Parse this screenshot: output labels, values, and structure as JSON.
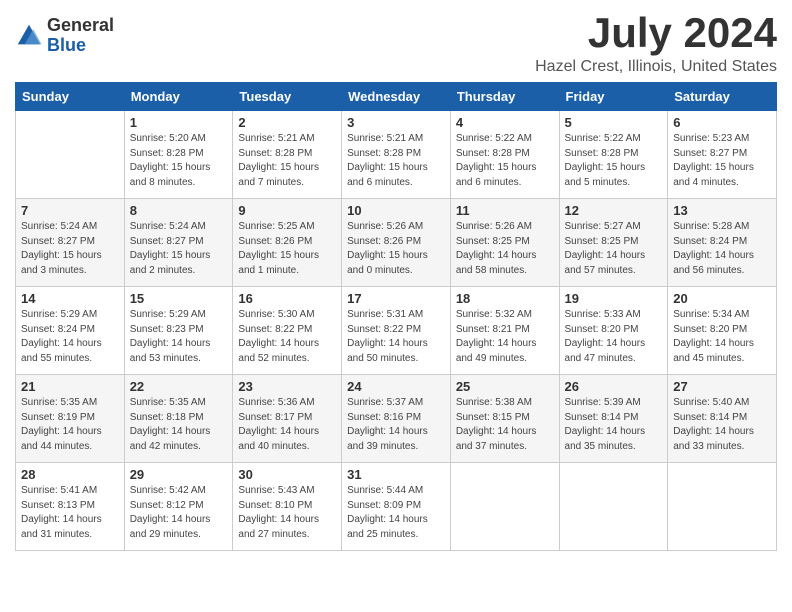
{
  "logo": {
    "general": "General",
    "blue": "Blue"
  },
  "title": {
    "month_year": "July 2024",
    "location": "Hazel Crest, Illinois, United States"
  },
  "headers": [
    "Sunday",
    "Monday",
    "Tuesday",
    "Wednesday",
    "Thursday",
    "Friday",
    "Saturday"
  ],
  "weeks": [
    [
      {
        "day": "",
        "info": ""
      },
      {
        "day": "1",
        "info": "Sunrise: 5:20 AM\nSunset: 8:28 PM\nDaylight: 15 hours\nand 8 minutes."
      },
      {
        "day": "2",
        "info": "Sunrise: 5:21 AM\nSunset: 8:28 PM\nDaylight: 15 hours\nand 7 minutes."
      },
      {
        "day": "3",
        "info": "Sunrise: 5:21 AM\nSunset: 8:28 PM\nDaylight: 15 hours\nand 6 minutes."
      },
      {
        "day": "4",
        "info": "Sunrise: 5:22 AM\nSunset: 8:28 PM\nDaylight: 15 hours\nand 6 minutes."
      },
      {
        "day": "5",
        "info": "Sunrise: 5:22 AM\nSunset: 8:28 PM\nDaylight: 15 hours\nand 5 minutes."
      },
      {
        "day": "6",
        "info": "Sunrise: 5:23 AM\nSunset: 8:27 PM\nDaylight: 15 hours\nand 4 minutes."
      }
    ],
    [
      {
        "day": "7",
        "info": "Sunrise: 5:24 AM\nSunset: 8:27 PM\nDaylight: 15 hours\nand 3 minutes."
      },
      {
        "day": "8",
        "info": "Sunrise: 5:24 AM\nSunset: 8:27 PM\nDaylight: 15 hours\nand 2 minutes."
      },
      {
        "day": "9",
        "info": "Sunrise: 5:25 AM\nSunset: 8:26 PM\nDaylight: 15 hours\nand 1 minute."
      },
      {
        "day": "10",
        "info": "Sunrise: 5:26 AM\nSunset: 8:26 PM\nDaylight: 15 hours\nand 0 minutes."
      },
      {
        "day": "11",
        "info": "Sunrise: 5:26 AM\nSunset: 8:25 PM\nDaylight: 14 hours\nand 58 minutes."
      },
      {
        "day": "12",
        "info": "Sunrise: 5:27 AM\nSunset: 8:25 PM\nDaylight: 14 hours\nand 57 minutes."
      },
      {
        "day": "13",
        "info": "Sunrise: 5:28 AM\nSunset: 8:24 PM\nDaylight: 14 hours\nand 56 minutes."
      }
    ],
    [
      {
        "day": "14",
        "info": "Sunrise: 5:29 AM\nSunset: 8:24 PM\nDaylight: 14 hours\nand 55 minutes."
      },
      {
        "day": "15",
        "info": "Sunrise: 5:29 AM\nSunset: 8:23 PM\nDaylight: 14 hours\nand 53 minutes."
      },
      {
        "day": "16",
        "info": "Sunrise: 5:30 AM\nSunset: 8:22 PM\nDaylight: 14 hours\nand 52 minutes."
      },
      {
        "day": "17",
        "info": "Sunrise: 5:31 AM\nSunset: 8:22 PM\nDaylight: 14 hours\nand 50 minutes."
      },
      {
        "day": "18",
        "info": "Sunrise: 5:32 AM\nSunset: 8:21 PM\nDaylight: 14 hours\nand 49 minutes."
      },
      {
        "day": "19",
        "info": "Sunrise: 5:33 AM\nSunset: 8:20 PM\nDaylight: 14 hours\nand 47 minutes."
      },
      {
        "day": "20",
        "info": "Sunrise: 5:34 AM\nSunset: 8:20 PM\nDaylight: 14 hours\nand 45 minutes."
      }
    ],
    [
      {
        "day": "21",
        "info": "Sunrise: 5:35 AM\nSunset: 8:19 PM\nDaylight: 14 hours\nand 44 minutes."
      },
      {
        "day": "22",
        "info": "Sunrise: 5:35 AM\nSunset: 8:18 PM\nDaylight: 14 hours\nand 42 minutes."
      },
      {
        "day": "23",
        "info": "Sunrise: 5:36 AM\nSunset: 8:17 PM\nDaylight: 14 hours\nand 40 minutes."
      },
      {
        "day": "24",
        "info": "Sunrise: 5:37 AM\nSunset: 8:16 PM\nDaylight: 14 hours\nand 39 minutes."
      },
      {
        "day": "25",
        "info": "Sunrise: 5:38 AM\nSunset: 8:15 PM\nDaylight: 14 hours\nand 37 minutes."
      },
      {
        "day": "26",
        "info": "Sunrise: 5:39 AM\nSunset: 8:14 PM\nDaylight: 14 hours\nand 35 minutes."
      },
      {
        "day": "27",
        "info": "Sunrise: 5:40 AM\nSunset: 8:14 PM\nDaylight: 14 hours\nand 33 minutes."
      }
    ],
    [
      {
        "day": "28",
        "info": "Sunrise: 5:41 AM\nSunset: 8:13 PM\nDaylight: 14 hours\nand 31 minutes."
      },
      {
        "day": "29",
        "info": "Sunrise: 5:42 AM\nSunset: 8:12 PM\nDaylight: 14 hours\nand 29 minutes."
      },
      {
        "day": "30",
        "info": "Sunrise: 5:43 AM\nSunset: 8:10 PM\nDaylight: 14 hours\nand 27 minutes."
      },
      {
        "day": "31",
        "info": "Sunrise: 5:44 AM\nSunset: 8:09 PM\nDaylight: 14 hours\nand 25 minutes."
      },
      {
        "day": "",
        "info": ""
      },
      {
        "day": "",
        "info": ""
      },
      {
        "day": "",
        "info": ""
      }
    ]
  ]
}
